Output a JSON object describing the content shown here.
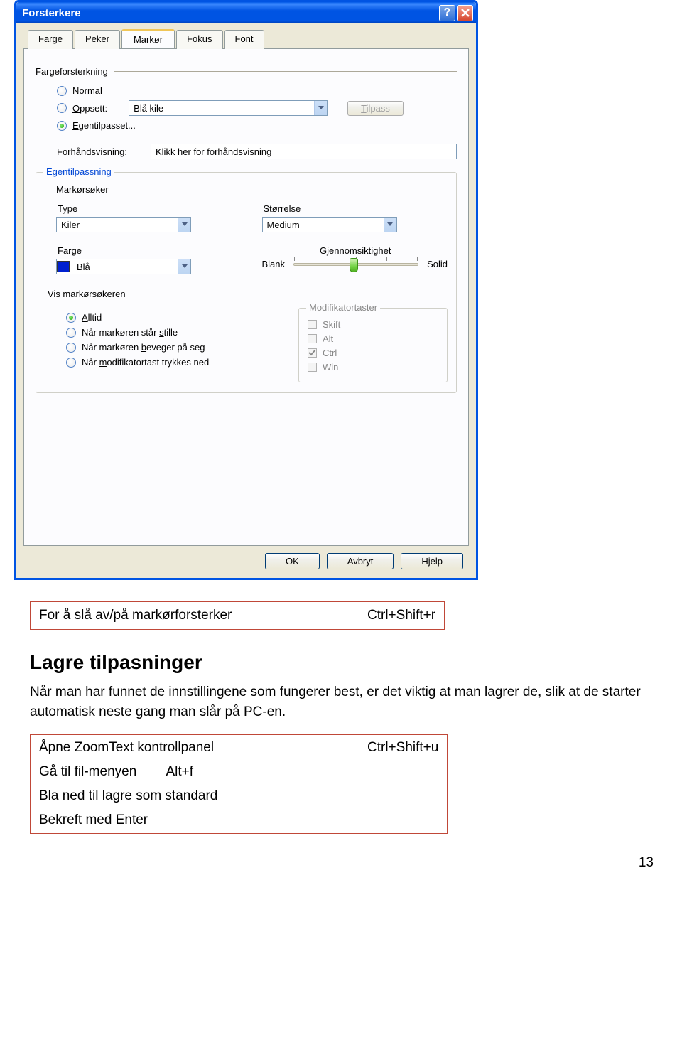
{
  "dialog": {
    "title": "Forsterkere",
    "tabs": [
      "Farge",
      "Peker",
      "Markør",
      "Fokus",
      "Font"
    ],
    "active_tab": 2,
    "color_strengthening": {
      "group_title": "Fargeforsterkning",
      "radios": {
        "normal": "Normal",
        "preset": "Oppsett:",
        "custom": "Egentilpasset..."
      },
      "preset_value": "Blå kile",
      "customize_btn": "Tilpass",
      "preview_label": "Forhåndsvisning:",
      "preview_value": "Klikk her for forhåndsvisning"
    },
    "customization": {
      "legend": "Egentilpassning",
      "cursor_seeker": "Markørsøker",
      "type_label": "Type",
      "type_value": "Kiler",
      "size_label": "Størrelse",
      "size_value": "Medium",
      "color_label": "Farge",
      "color_value": "Blå",
      "transparency_label": "Gjennomsiktighet",
      "slider_left": "Blank",
      "slider_right": "Solid"
    },
    "show_cursor": {
      "label": "Vis markørsøkeren",
      "radios": {
        "always": "Alltid",
        "still": "Når markøren står stille",
        "moving": "Når markøren beveger på seg",
        "modifier": "Når modifikatortast trykkes ned"
      },
      "mod_legend": "Modifikatortaster",
      "mods": {
        "shift": "Skift",
        "alt": "Alt",
        "ctrl": "Ctrl",
        "win": "Win"
      }
    },
    "buttons": {
      "ok": "OK",
      "cancel": "Avbryt",
      "help": "Hjelp"
    }
  },
  "doc": {
    "table1": {
      "left": "For å slå av/på markørforsterker",
      "right": "Ctrl+Shift+r"
    },
    "heading": "Lagre tilpasninger",
    "para": "Når man har funnet de innstillingene som fungerer best, er det viktig at man lagrer de, slik at de starter automatisk neste gang man slår på PC-en.",
    "table2": {
      "r1c1": "Åpne ZoomText kontrollpanel",
      "r1c2": "Ctrl+Shift+u",
      "r2": "Gå til fil-menyen        Alt+f",
      "r3": "Bla ned til lagre som standard",
      "r4": "Bekreft med Enter"
    },
    "page": "13"
  }
}
